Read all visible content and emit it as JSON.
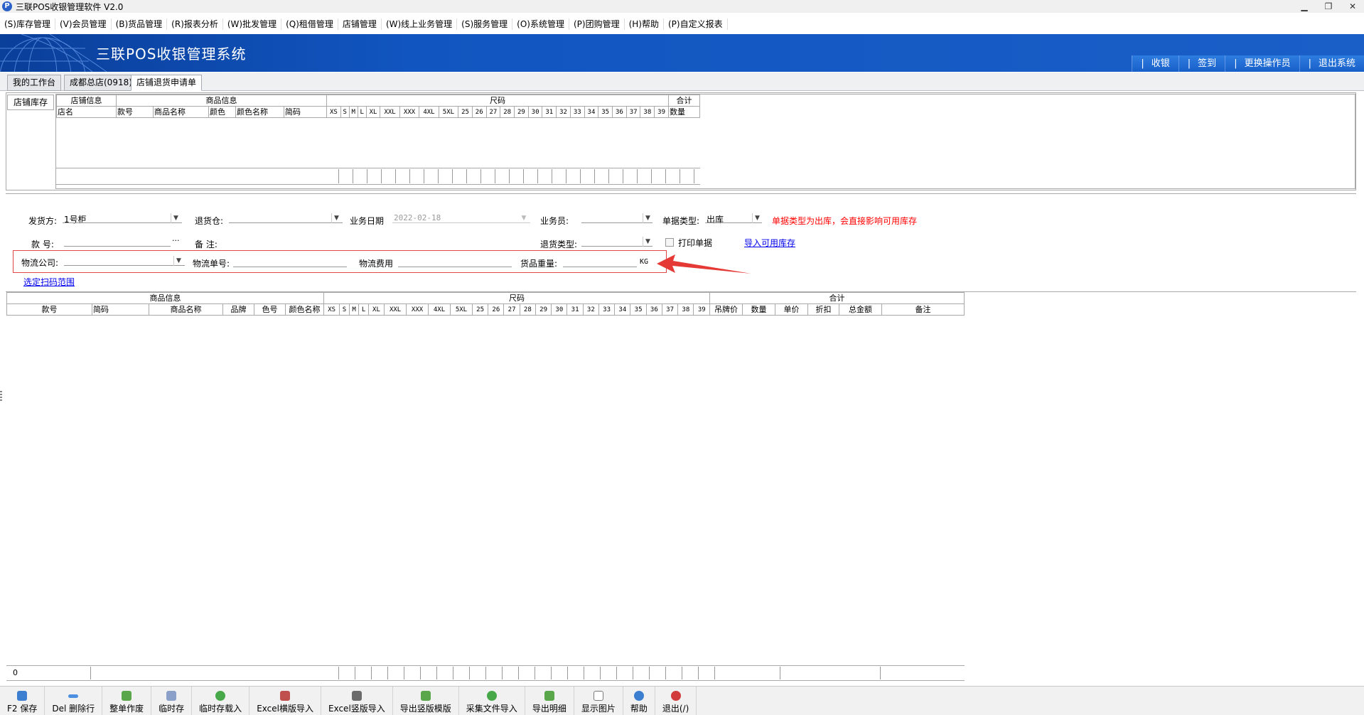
{
  "window": {
    "title": "三联POS收银管理软件 V2.0",
    "logo_letter": "P",
    "minimize": "▁",
    "restore": "❐",
    "close": "✕"
  },
  "menu": [
    "(S)库存管理",
    "(V)会员管理",
    "(B)货品管理",
    "(R)报表分析",
    "(W)批发管理",
    "(Q)租借管理",
    "店铺管理",
    "(W)线上业务管理",
    "(S)服务管理",
    "(O)系统管理",
    "(P)团购管理",
    "(H)帮助",
    "(P)自定义报表"
  ],
  "banner": {
    "title": "三联POS收银管理系统",
    "links": [
      "收银",
      "签到",
      "更换操作员",
      "退出系统"
    ]
  },
  "tabs": [
    "我的工作台",
    "成都总店(0918)",
    "店铺退货申请单"
  ],
  "inventory": {
    "side_label": "店铺库存",
    "groups": {
      "store": "店铺信息",
      "product": "商品信息",
      "size": "尺码",
      "total": "合计"
    },
    "columns": {
      "store_name": "店名",
      "style_no": "款号",
      "product_name": "商品名称",
      "color": "颜色",
      "color_name": "颜色名称",
      "code": "简码",
      "qty": "数量"
    },
    "sizes": [
      "XS",
      "S",
      "M",
      "L",
      "XL",
      "XXL",
      "XXX",
      "4XL",
      "5XL",
      "25",
      "26",
      "27",
      "28",
      "29",
      "30",
      "31",
      "32",
      "33",
      "34",
      "35",
      "36",
      "37",
      "38",
      "39"
    ]
  },
  "form": {
    "sender_label": "发货方:",
    "sender_value": "1号柜",
    "return_wh_label": "退货仓:",
    "date_label": "业务日期",
    "date_value": "2022-02-18",
    "salesman_label": "业务员:",
    "doctype_label": "单据类型:",
    "doctype_value": "出库",
    "warning": "单据类型为出库，会直接影响可用库存",
    "style_label": "款  号:",
    "style_btn": "···",
    "remark_label": "备  注:",
    "return_type_label": "退货类型:",
    "print_label": "打印单据",
    "import_link": "导入可用库存",
    "logistics_company_label": "物流公司:",
    "logistics_no_label": "物流单号:",
    "logistics_fee_label": "物流费用",
    "weight_label": "货品重量:",
    "weight_unit": "KG",
    "scan_link": "选定扫码范围",
    "dropdown_arrow": "▼"
  },
  "detail": {
    "groups": {
      "product": "商品信息",
      "size": "尺码",
      "total": "合计"
    },
    "columns": {
      "style_no": "款号",
      "code": "简码",
      "product_name": "商品名称",
      "brand": "品牌",
      "color_no": "色号",
      "color_name": "颜色名称",
      "tag_price": "吊牌价",
      "qty": "数量",
      "price": "单价",
      "discount": "折扣",
      "amount": "总金额",
      "remark": "备注"
    },
    "sizes": [
      "XS",
      "S",
      "M",
      "L",
      "XL",
      "XXL",
      "XXX",
      "4XL",
      "5XL",
      "25",
      "26",
      "27",
      "28",
      "29",
      "30",
      "31",
      "32",
      "33",
      "34",
      "35",
      "36",
      "37",
      "38",
      "39"
    ],
    "footer_count": "0"
  },
  "toolbar": [
    {
      "label": "F2 保存",
      "color": "#3c7fd0",
      "icon": "save-icon"
    },
    {
      "label": "Del 删除行",
      "color": "#4d8fe0",
      "icon": "delete-row-icon"
    },
    {
      "label": "整单作废",
      "color": "#5aa64a",
      "icon": "basket-icon"
    },
    {
      "label": "临时存",
      "color": "#8aa0c8",
      "icon": "temp-save-icon"
    },
    {
      "label": "临时存载入",
      "color": "#47a84a",
      "icon": "load-icon"
    },
    {
      "label": "Excel横版导入",
      "color": "#c0504d",
      "icon": "excel-import-icon"
    },
    {
      "label": "Excel竖版导入",
      "color": "#6b6b6b",
      "icon": "excel-vertical-icon"
    },
    {
      "label": "导出竖版模版",
      "color": "#5aa64a",
      "icon": "export-template-icon"
    },
    {
      "label": "采集文件导入",
      "color": "#47a84a",
      "icon": "collect-import-icon"
    },
    {
      "label": "导出明细",
      "color": "#5aa64a",
      "icon": "export-detail-icon"
    },
    {
      "label": "显示图片",
      "color": "#7a7a7a",
      "icon": "image-icon"
    },
    {
      "label": "帮助",
      "color": "#3c7fd0",
      "icon": "help-icon"
    },
    {
      "label": "退出(/)",
      "color": "#d23b3b",
      "icon": "exit-icon"
    }
  ],
  "colors": {
    "warning": "#ff0000",
    "highlight_box": "#e04848",
    "arrow": "#e53935",
    "banner": "#1155c0"
  }
}
